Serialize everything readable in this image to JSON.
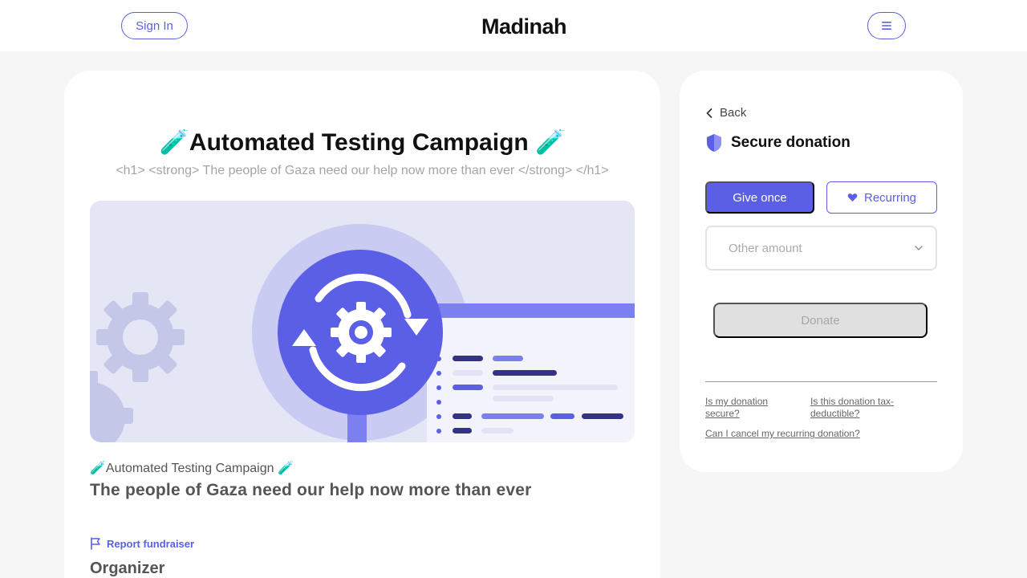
{
  "header": {
    "signin_label": "Sign In",
    "logo_text": "Madinah"
  },
  "campaign": {
    "title": "🧪Automated Testing Campaign 🧪",
    "subtitle": "<h1> <strong> The people of Gaza need our help now more than ever </strong> </h1>",
    "small_title": "🧪Automated Testing Campaign 🧪",
    "headline": "The people of Gaza need our help now more than ever",
    "report_label": "Report fundraiser",
    "organizer_label": "Organizer"
  },
  "donation": {
    "back_label": "Back",
    "secure_label": "Secure donation",
    "give_once_label": "Give once",
    "recurring_label": "Recurring",
    "amount_placeholder": "Other amount",
    "donate_label": "Donate",
    "faq": [
      "Is my donation secure?",
      "Is this donation tax-deductible?",
      "Can I cancel my recurring donation?"
    ]
  },
  "colors": {
    "accent": "#5b5fe6",
    "background": "#f6f6f6"
  },
  "icons": {
    "menu": "hamburger-icon",
    "back": "chevron-left-icon",
    "secure": "shield-icon",
    "recurring": "heart-icon",
    "dropdown": "chevron-down-icon",
    "report": "flag-icon"
  }
}
